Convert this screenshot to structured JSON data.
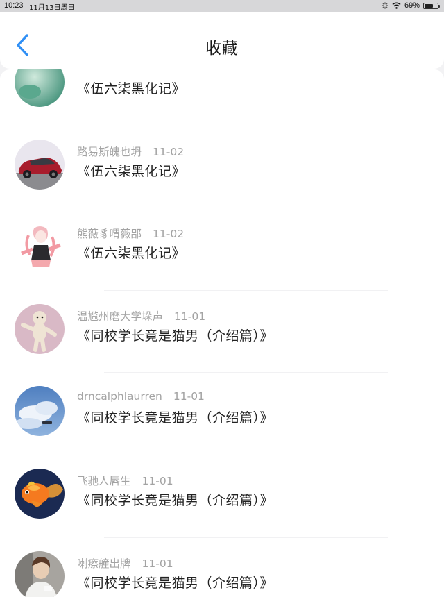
{
  "status": {
    "time": "10:23",
    "date": "11月13日周日",
    "battery": "69%",
    "battery_level": 0.69
  },
  "header": {
    "title": "收藏"
  },
  "items": [
    {
      "author": "",
      "date": "",
      "title": "《伍六柒黑化记》",
      "avatar": "green-avatar-partial"
    },
    {
      "author": "路易斯魄也坍",
      "date": "11-02",
      "title": "《伍六柒黑化记》",
      "avatar": "red-car-avatar"
    },
    {
      "author": "熊薇豸喟薇郘",
      "date": "11-02",
      "title": "《伍六柒黑化记》",
      "avatar": "anime-girl-avatar"
    },
    {
      "author": "温尴州磨大学垛声",
      "date": "11-01",
      "title": "《同校学长竟是猫男（介绍篇）》",
      "avatar": "dog-avatar"
    },
    {
      "author": "drncalphlaurren",
      "date": "11-01",
      "title": "《同校学长竟是猫男（介绍篇）》",
      "avatar": "sky-clouds-avatar"
    },
    {
      "author": "飞驰人唇生",
      "date": "11-01",
      "title": "《同校学长竟是猫男（介绍篇）》",
      "avatar": "goldfish-avatar"
    },
    {
      "author": "喇瘵艟出牌",
      "date": "11-01",
      "title": "《同校学长竟是猫男（介绍篇）》",
      "avatar": "person-avatar"
    }
  ]
}
